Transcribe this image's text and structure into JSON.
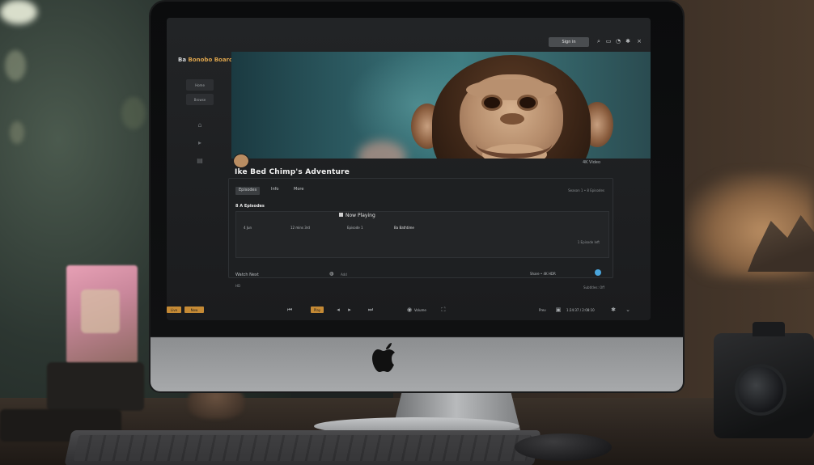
{
  "scene": {
    "subject": "iMac on a desk displaying a streaming app with a cartoon chimpanzee",
    "colors": {
      "accent": "#d9a24c",
      "hero_teal": "#3f7d82",
      "screen_bg": "#1b1c1e",
      "link_blue": "#4aa5dc"
    }
  },
  "app": {
    "brand_prefix": "Ba",
    "brand_name": "Bonobo Board",
    "topbar_button": "Sign in",
    "icons": [
      "search-icon",
      "cast-icon",
      "bell-icon",
      "gear-icon",
      "close-icon"
    ]
  },
  "sidebar": {
    "items": [
      {
        "label": "Home"
      },
      {
        "label": "Browse"
      }
    ]
  },
  "hero": {
    "label": "4K Video",
    "title": "Ike Bed Chimp's Adventure"
  },
  "panel": {
    "tabs": [
      "Episodes",
      "Info",
      "More"
    ],
    "right_info": "Season 1 • 8 Episodes",
    "row_heading": "8 A Episodes",
    "row_center": "Now Playing",
    "cells": [
      "4 Jun",
      "12 mins 3rd",
      "Episode 1",
      "Ba Bathtime"
    ],
    "row_badge": "1 Episode left",
    "footer_left": "Watch Next",
    "footer_mid": "Add",
    "footer_right": "Share • 4K HDR",
    "footer_bottom": "HD",
    "footer_bottom_right": "Subtitles: Off"
  },
  "dock": {
    "left_buttons": [
      "Live",
      "Now"
    ],
    "center_items": [
      "Play",
      "Prev",
      "Next"
    ],
    "right_text": "Volume",
    "right_text2": "1:24:37 / 2:08:10"
  }
}
